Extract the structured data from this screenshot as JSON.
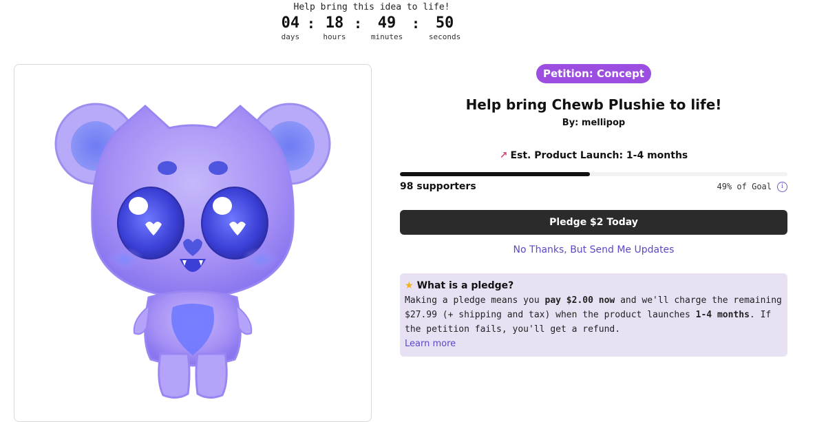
{
  "countdown": {
    "title": "Help bring this idea to life!",
    "days": "04",
    "days_label": "days",
    "hours": "18",
    "hours_label": "hours",
    "minutes": "49",
    "minutes_label": "minutes",
    "seconds": "50",
    "seconds_label": "seconds",
    "separator": ":"
  },
  "product": {
    "badge": "Petition: Concept",
    "title": "Help bring Chewb Plushie to life!",
    "author": "By: mellipop",
    "launch_icon": "rocket-icon",
    "launch": "Est. Product Launch: 1-4 months",
    "progress_fraction": 0.49,
    "supporters": "98 supporters",
    "goal": "49% of Goal",
    "info_icon": "i"
  },
  "actions": {
    "pledge_label": "Pledge $2 Today",
    "updates_label": "No Thanks, But Send Me Updates"
  },
  "pledge_info": {
    "star_icon": "★",
    "title": "What is a pledge?",
    "text_1": "Making a pledge means you ",
    "bold_1": "pay $2.00 now",
    "text_2": " and we'll charge the remaining $27.99 (+ shipping and tax) when the product launches ",
    "bold_2": "1-4 months",
    "text_3": ". If the petition fails, you'll get a refund.",
    "learn_more": "Learn more"
  },
  "colors": {
    "badge": "#9b4ee0",
    "button": "#2b2b2b",
    "link": "#5b48c9",
    "info_box": "#e8e1f4",
    "plush_body": "#a58ff5",
    "plush_eye": "#3b3fd6"
  }
}
